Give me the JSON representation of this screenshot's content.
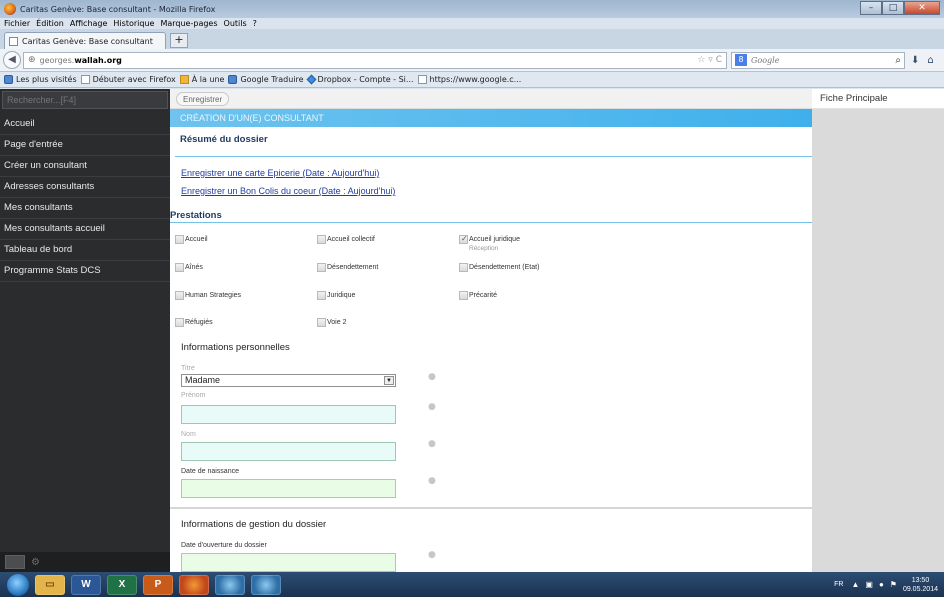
{
  "window": {
    "title": "Caritas Genève: Base consultant - Mozilla Firefox",
    "minimize": "–",
    "maximize": "□",
    "close": "✕"
  },
  "menubar": [
    "Fichier",
    "Édition",
    "Affichage",
    "Historique",
    "Marque-pages",
    "Outils",
    "?"
  ],
  "tab": {
    "title": "Caritas Genève: Base consultant",
    "new_tab": "+"
  },
  "nav": {
    "url_prefix": "georges.",
    "url_host": "wallah.org",
    "search_placeholder": "Google",
    "search_engine_glyph": "8"
  },
  "bookmarks": [
    {
      "label": "Les plus visités",
      "icon": "bookmark-icon"
    },
    {
      "label": "Débuter avec Firefox",
      "icon": "page-icon"
    },
    {
      "label": "À la une",
      "icon": "rss-icon"
    },
    {
      "label": "Google Traduire",
      "icon": "translate-icon"
    },
    {
      "label": "Dropbox - Compte - Si...",
      "icon": "dropbox-icon"
    },
    {
      "label": "https://www.google.c...",
      "icon": "page-icon"
    }
  ],
  "sidebar": {
    "search_placeholder": "Rechercher...[F4]",
    "items": [
      "Accueil",
      "Page d'entrée",
      "Créer un consultant",
      "Adresses consultants",
      "Mes consultants",
      "Mes consultants accueil",
      "Tableau de bord",
      "Programme Stats DCS"
    ]
  },
  "toolbar": {
    "save_label": "Enregistrer"
  },
  "form": {
    "header": "CRÉATION D'UN(E) CONSULTANT",
    "resume_title": "Résumé du dossier",
    "links": [
      "Enregistrer une carte Epicerie (Date : Aujourd'hui)",
      "Enregistrer un Bon Colis du coeur (Date : Aujourd'hui)"
    ],
    "prestations_title": "Prestations",
    "prestations": [
      {
        "label": "Accueil",
        "checked": false
      },
      {
        "label": "Accueil collectif",
        "checked": false
      },
      {
        "label": "Accueil juridique",
        "checked": true,
        "sub": "Réception"
      },
      {
        "label": "Aînés",
        "checked": false
      },
      {
        "label": "Désendettement",
        "checked": false
      },
      {
        "label": "Désendettement (Etat)",
        "checked": false
      },
      {
        "label": "Human Strategies",
        "checked": false
      },
      {
        "label": "Juridique",
        "checked": false
      },
      {
        "label": "Précarité",
        "checked": false
      },
      {
        "label": "Réfugiés",
        "checked": false
      },
      {
        "label": "Voie 2",
        "checked": false
      }
    ],
    "personal_title": "Informations personnelles",
    "titre_label": "Titre",
    "titre_value": "Madame",
    "prenom_label": "Prénom",
    "nom_label": "Nom",
    "dob_label": "Date de naissance",
    "gestion_title": "Informations de gestion du dossier",
    "opening_label": "Date d'ouverture du dossier"
  },
  "right_panel": {
    "title": "Fiche Principale"
  },
  "taskbar": {
    "apps": [
      "W",
      "X",
      "P"
    ],
    "lang": "FR",
    "time": "13:50",
    "date": "09.05.2014"
  }
}
